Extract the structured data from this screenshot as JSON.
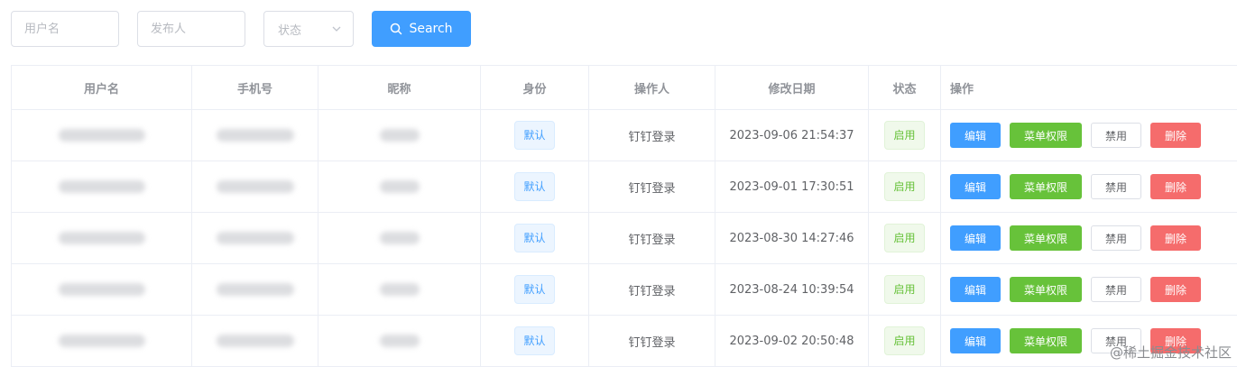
{
  "filters": {
    "username_placeholder": "用户名",
    "publisher_placeholder": "发布人",
    "status_placeholder": "状态",
    "search_label": "Search"
  },
  "table": {
    "headers": [
      "用户名",
      "手机号",
      "昵称",
      "身份",
      "操作人",
      "修改日期",
      "状态",
      "操作"
    ],
    "rows": [
      {
        "role": "默认",
        "operator": "钉钉登录",
        "date": "2023-09-06 21:54:37",
        "status": "启用"
      },
      {
        "role": "默认",
        "operator": "钉钉登录",
        "date": "2023-09-01 17:30:51",
        "status": "启用"
      },
      {
        "role": "默认",
        "operator": "钉钉登录",
        "date": "2023-08-30 14:27:46",
        "status": "启用"
      },
      {
        "role": "默认",
        "operator": "钉钉登录",
        "date": "2023-08-24 10:39:54",
        "status": "启用"
      },
      {
        "role": "默认",
        "operator": "钉钉登录",
        "date": "2023-09-02 20:50:48",
        "status": "启用"
      }
    ],
    "actions": {
      "edit": "编辑",
      "menu_perm": "菜单权限",
      "disable": "禁用",
      "delete": "删除"
    }
  },
  "watermark": "@稀土掘金技术社区",
  "colors": {
    "primary": "#409eff",
    "success": "#67c23a",
    "danger": "#f56c6c",
    "border": "#ebeef5"
  }
}
